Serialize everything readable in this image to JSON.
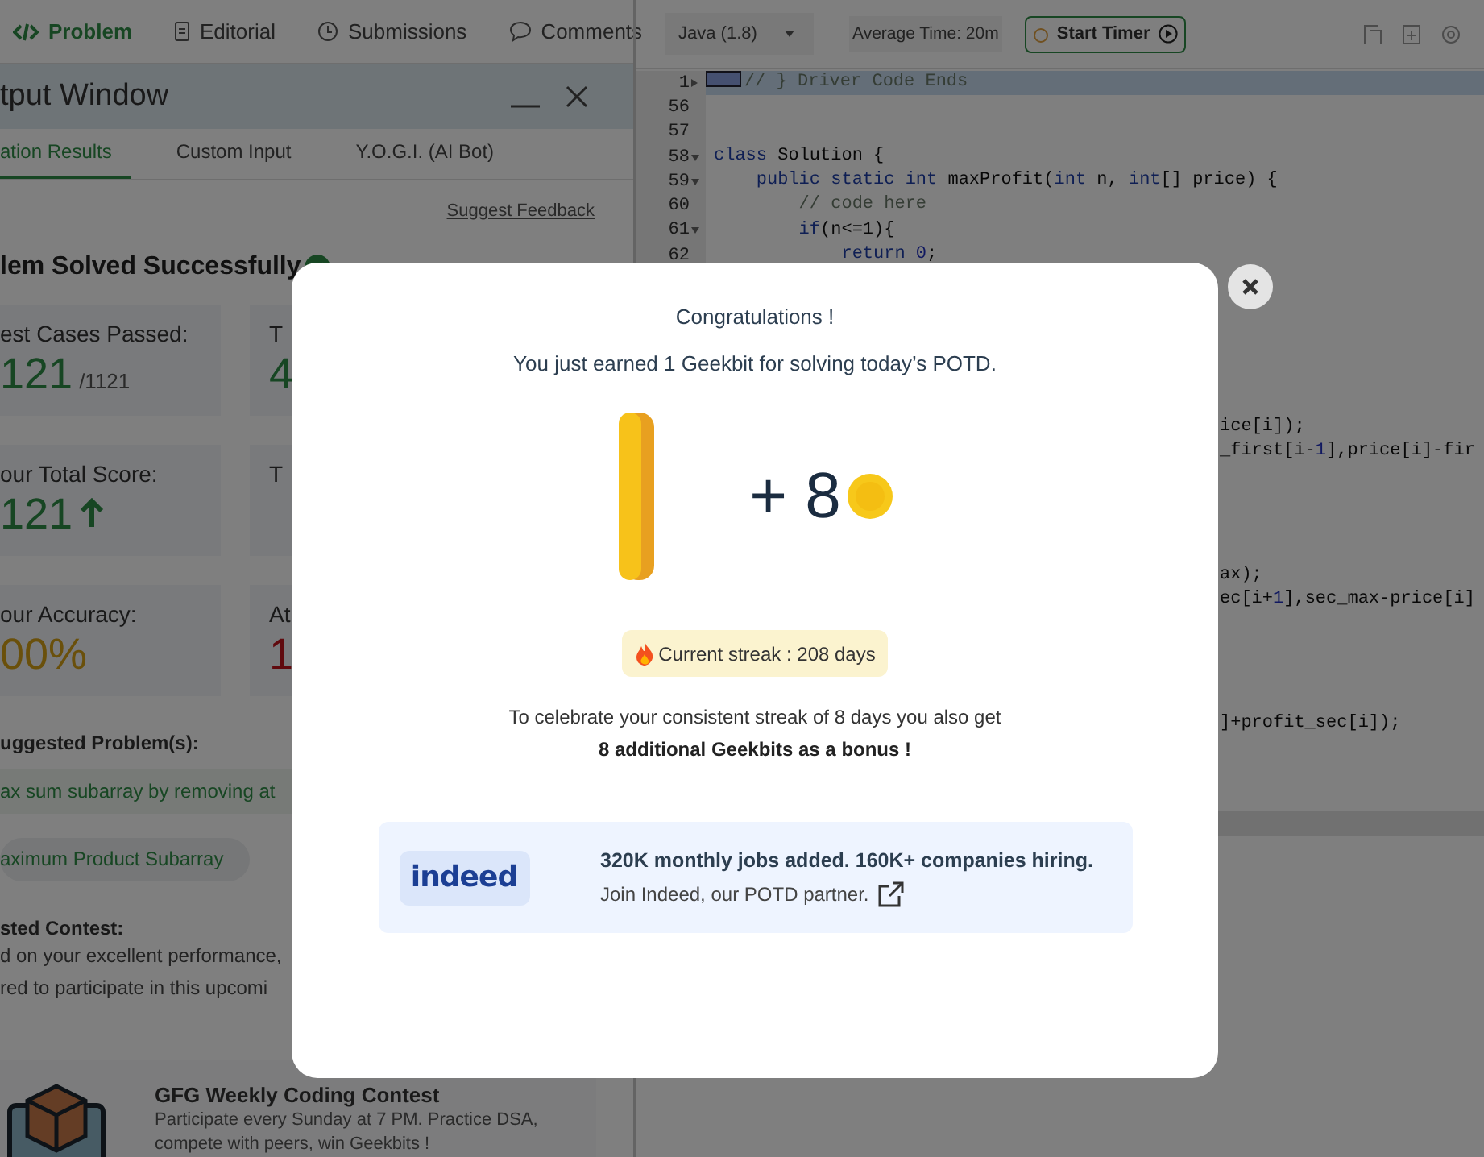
{
  "problem_tabs": [
    {
      "label": "Problem",
      "kind": "code",
      "selected": true
    },
    {
      "label": "Editorial",
      "kind": "document",
      "selected": false
    },
    {
      "label": "Submissions",
      "kind": "clock",
      "selected": false
    },
    {
      "label": "Comments",
      "kind": "chat",
      "selected": false
    }
  ],
  "output_window": {
    "title": "tput Window",
    "tabs": [
      {
        "label": "ation Results",
        "selected": true
      },
      {
        "label": "Custom Input",
        "selected": false
      },
      {
        "label": "Y.O.G.I. (AI Bot)",
        "selected": false
      }
    ],
    "feedback_link": "Suggest Feedback",
    "status": "lem Solved Successfully",
    "stats": [
      {
        "label": "est Cases Passed:",
        "value": "121",
        "total": "/1121",
        "kind": "good"
      },
      {
        "label": "T",
        "value": "4",
        "kind": "good"
      },
      {
        "label": "our Total Score:",
        "value": "121",
        "rising": true,
        "kind": "good"
      },
      {
        "label": "T"
      },
      {
        "label": "our Accuracy:",
        "value": "00%",
        "kind": "fair"
      },
      {
        "label": "At",
        "value": "1",
        "kind": "bad"
      }
    ],
    "suggested_heading": "uggested Problem(s):",
    "suggested_problem": "ax sum subarray by removing at",
    "suggested_tags": [
      "aximum Product Subarray"
    ],
    "contest_heading": "sted Contest:",
    "contest_note_lines": [
      "d on your excellent performance,",
      "red to participate in this upcomi"
    ],
    "contest": {
      "title": "GFG Weekly Coding Contest",
      "lines": [
        "Participate every Sunday at 7 PM. Practice DSA,",
        "compete with peers, win Geekbits !"
      ]
    }
  },
  "editor": {
    "language": "Java (1.8)",
    "average_time": "Average Time: 20m",
    "timer_button": "Start Timer",
    "lines": [
      {
        "kind": "code",
        "number": "1",
        "foldable": true,
        "collapsed": true,
        "selected": true,
        "tokens": [
          {
            "kind": "comment",
            "text": "// } Driver Code Ends"
          }
        ]
      },
      {
        "kind": "code",
        "number": "56",
        "selected": false
      },
      {
        "kind": "code",
        "number": "57",
        "selected": false
      },
      {
        "kind": "code",
        "number": "58",
        "foldable": true,
        "collapsed": false,
        "selected": false,
        "tokens": [
          {
            "kind": "keyword",
            "text": "class"
          },
          {
            "kind": "plain",
            "text": " Solution {"
          }
        ]
      },
      {
        "kind": "code",
        "number": "59",
        "foldable": true,
        "collapsed": false,
        "selected": false,
        "tokens": [
          {
            "kind": "keyword",
            "text": "    public static int"
          },
          {
            "kind": "plain",
            "text": " maxProfit("
          },
          {
            "kind": "keyword",
            "text": "int"
          },
          {
            "kind": "plain",
            "text": " n, "
          },
          {
            "kind": "keyword",
            "text": "int"
          },
          {
            "kind": "plain",
            "text": "[] price) {"
          }
        ]
      },
      {
        "kind": "code",
        "number": "60",
        "selected": false,
        "tokens": [
          {
            "kind": "comment",
            "text": "        // code here"
          }
        ]
      },
      {
        "kind": "code",
        "number": "61",
        "foldable": true,
        "collapsed": false,
        "selected": false,
        "tokens": [
          {
            "kind": "keyword",
            "text": "        if"
          },
          {
            "kind": "plain",
            "text": "(n<=1){"
          }
        ]
      },
      {
        "kind": "code",
        "number": "62",
        "selected": false,
        "tokens": [
          {
            "kind": "keyword",
            "text": "            return"
          },
          {
            "kind": "number",
            "text": " 0"
          },
          {
            "kind": "plain",
            "text": ";"
          }
        ]
      },
      {
        "kind": "hidden"
      },
      {
        "kind": "hidden"
      },
      {
        "kind": "hidden"
      },
      {
        "kind": "hidden"
      },
      {
        "kind": "hidden"
      },
      {
        "kind": "hidden"
      },
      {
        "kind": "fragment",
        "tokens": [
          {
            "kind": "plain",
            "text": "ice[i]);"
          }
        ]
      },
      {
        "kind": "fragment",
        "tokens": [
          {
            "kind": "plain",
            "text": "_first[i-"
          },
          {
            "kind": "number",
            "text": "1"
          },
          {
            "kind": "plain",
            "text": "],price[i]-fir"
          }
        ]
      },
      {
        "kind": "hidden"
      },
      {
        "kind": "hidden"
      },
      {
        "kind": "hidden"
      },
      {
        "kind": "hidden"
      },
      {
        "kind": "fragment",
        "tokens": [
          {
            "kind": "plain",
            "text": "ax);"
          }
        ]
      },
      {
        "kind": "fragment",
        "tokens": [
          {
            "kind": "plain",
            "text": "ec[i+"
          },
          {
            "kind": "number",
            "text": "1"
          },
          {
            "kind": "plain",
            "text": "],sec_max-price[i]"
          }
        ]
      },
      {
        "kind": "hidden"
      },
      {
        "kind": "hidden"
      },
      {
        "kind": "hidden"
      },
      {
        "kind": "hidden"
      },
      {
        "kind": "fragment",
        "tokens": [
          {
            "kind": "plain",
            "text": "]+profit_sec[i]);"
          }
        ]
      }
    ]
  },
  "popup": {
    "title": "Congratulations !",
    "subtitle": "You just earned 1 Geekbit for solving today’s POTD.",
    "bonus": "+ 8",
    "streak": "Current streak : 208 days",
    "note": "To celebrate your consistent streak of 8 days you also get",
    "note_bold": "8 additional Geekbits as a bonus !",
    "partner": {
      "logo": "indeed",
      "headline": "320K monthly jobs added. 160K+ companies hiring.",
      "text": "Join Indeed, our POTD partner."
    }
  }
}
